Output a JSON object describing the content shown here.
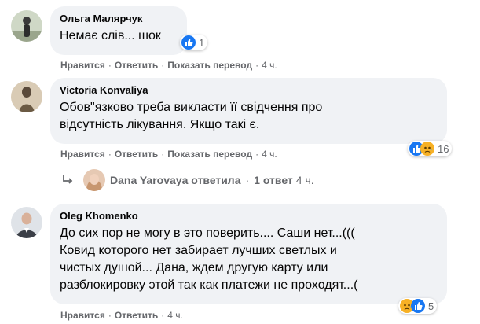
{
  "comments": [
    {
      "author": "Ольга Малярчук",
      "text": "Немає слів... шок",
      "actions": {
        "like": "Нравится",
        "reply": "Ответить",
        "translate": "Показать перевод",
        "time": "4 ч."
      },
      "reactions": {
        "icons": [
          "like-icon"
        ],
        "count": "1"
      }
    },
    {
      "author": "Victoria Konvaliya",
      "text": "Обов\"язково треба викласти її свідчення про\nвідсутність лікування. Якщо такі є.",
      "actions": {
        "like": "Нравится",
        "reply": "Ответить",
        "translate": "Показать перевод",
        "time": "4 ч."
      },
      "reactions": {
        "icons": [
          "like-icon",
          "sad-icon"
        ],
        "count": "16"
      }
    },
    {
      "author": "Oleg Khomenko",
      "text": "До сих пор не могу в это поверить.... Саши нет...(((\nКовид которого нет забирает лучших светлых и\nчистых душой... Дана, ждем другую карту или\nразблокировку этой так как платежи не проходят...(",
      "actions": {
        "like": "Нравится",
        "reply": "Ответить",
        "time": "4 ч."
      },
      "reactions": {
        "icons": [
          "sad-icon",
          "like-icon"
        ],
        "count": "5"
      }
    }
  ],
  "reply_summary": {
    "name": "Dana Yarovaya",
    "verb": "ответила",
    "count": "1 ответ",
    "time": "4 ч."
  },
  "colors": {
    "bubble": "#f0f2f5",
    "meta": "#65676b",
    "like": "#1877f2",
    "sad": "#f7b125"
  }
}
